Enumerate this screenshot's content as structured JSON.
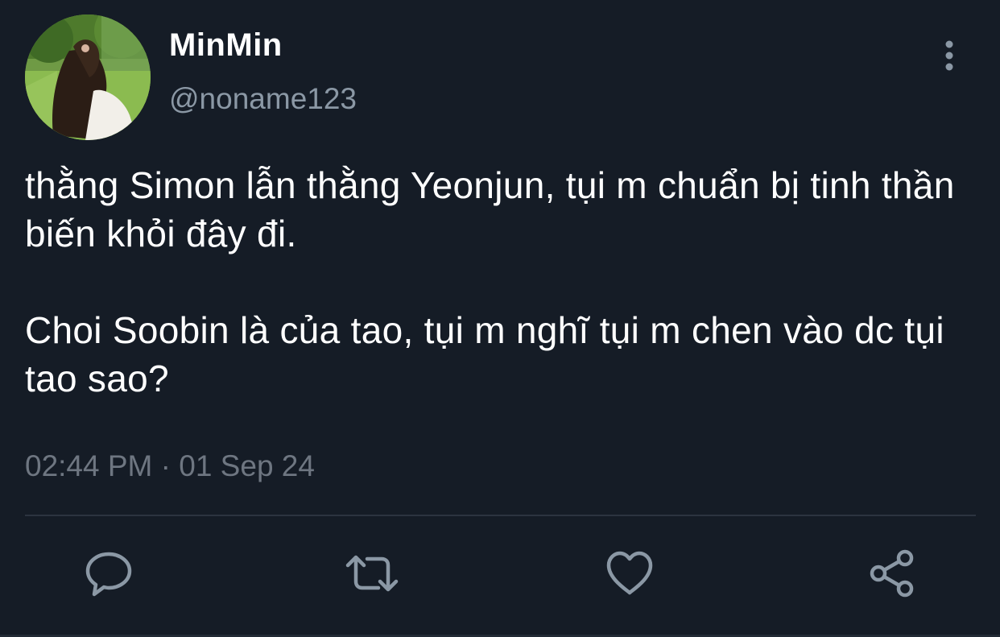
{
  "tweet": {
    "author": {
      "display_name": "MinMin",
      "handle": "@noname123"
    },
    "text_paragraphs": [
      "thằng Simon lẫn thằng Yeonjun, tụi m chuẩn bị tinh thần biến khỏi đây đi.",
      "Choi Soobin là của tao, tụi m nghĩ tụi m chen vào dc tụi tao sao?"
    ],
    "timestamp": "02:44 PM · 01 Sep 24"
  },
  "actions": [
    {
      "name": "reply",
      "icon": "comment-icon"
    },
    {
      "name": "retweet",
      "icon": "retweet-icon"
    },
    {
      "name": "like",
      "icon": "heart-icon"
    },
    {
      "name": "share",
      "icon": "share-icon"
    }
  ],
  "colors": {
    "background": "#151c26",
    "text": "#ffffff",
    "secondary_text": "#8b98a5",
    "icon": "#8b98a5"
  }
}
